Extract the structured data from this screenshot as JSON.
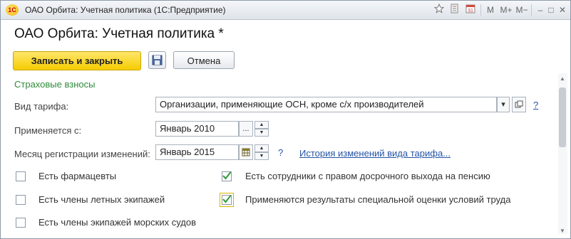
{
  "window": {
    "title": "ОАО Орбита: Учетная политика  (1С:Предприятие)",
    "logo_text": "1С",
    "toolbar": {
      "m": "M",
      "m_plus": "M+",
      "m_minus": "M−",
      "minimize": "–",
      "maximize": "□",
      "close": "✕"
    }
  },
  "form": {
    "title": "ОАО Орбита: Учетная политика *",
    "buttons": {
      "save_close": "Записать и закрыть",
      "cancel": "Отмена"
    },
    "section": "Страховые взносы",
    "tariff": {
      "label": "Вид тарифа:",
      "value": "Организации, применяющие ОСН, кроме с/х производителей",
      "help": "?"
    },
    "applies_from": {
      "label": "Применяется с:",
      "value": "Январь 2010",
      "ellipsis": "..."
    },
    "reg_month": {
      "label": "Месяц регистрации изменений:",
      "value": "Январь 2015",
      "help": "?",
      "history_link": "История изменений вида тарифа..."
    },
    "checkboxes": {
      "pharmacists": {
        "label": "Есть фармацевты",
        "checked": false
      },
      "flight_crew": {
        "label": "Есть члены летных экипажей",
        "checked": false
      },
      "sea_crew": {
        "label": "Есть члены экипажей морских судов",
        "checked": false
      },
      "early_retirement": {
        "label": "Есть сотрудники с правом досрочного выхода на пенсию",
        "checked": true
      },
      "special_assessment": {
        "label": "Применяются результаты специальной оценки условий труда",
        "checked": true
      }
    }
  },
  "colors": {
    "accent_green": "#2e8b3a",
    "link_blue": "#2454a6",
    "save_yellow": "#f5cc00"
  }
}
